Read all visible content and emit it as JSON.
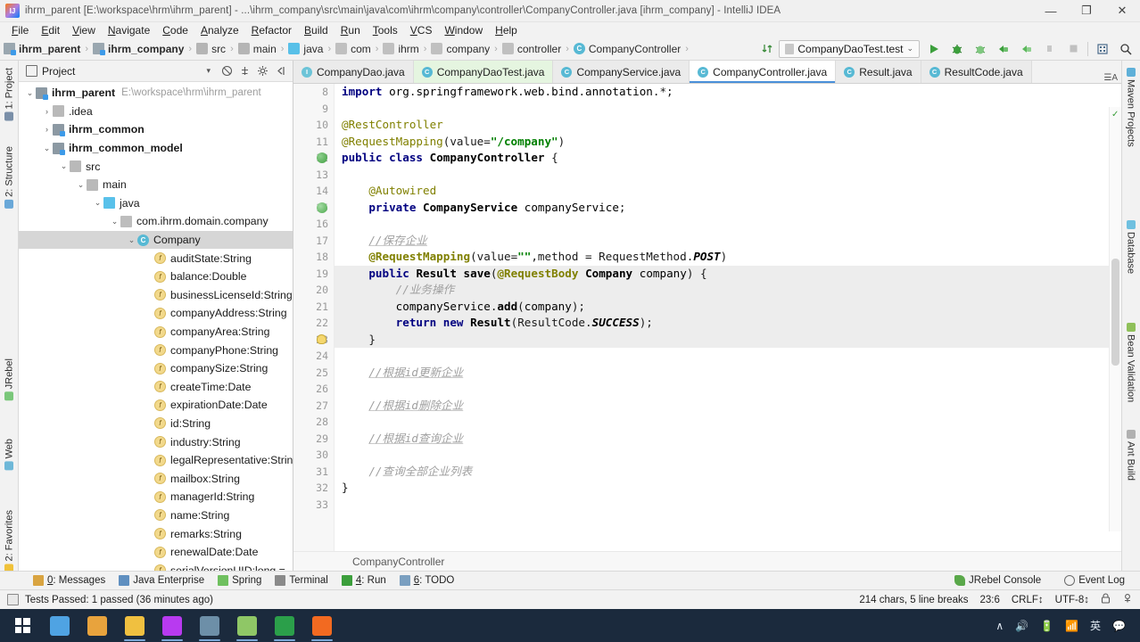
{
  "window": {
    "title": "ihrm_parent [E:\\workspace\\hrm\\ihrm_parent] - ...\\ihrm_company\\src\\main\\java\\com\\ihrm\\company\\controller\\CompanyController.java [ihrm_company] - IntelliJ IDEA",
    "minimize": "—",
    "maximize": "❐",
    "close": "✕"
  },
  "menu": [
    "File",
    "Edit",
    "View",
    "Navigate",
    "Code",
    "Analyze",
    "Refactor",
    "Build",
    "Run",
    "Tools",
    "VCS",
    "Window",
    "Help"
  ],
  "breadcrumb": [
    {
      "label": "ihrm_parent",
      "icon": "module-icon",
      "bold": true
    },
    {
      "label": "ihrm_company",
      "icon": "module-icon",
      "bold": true
    },
    {
      "label": "src",
      "icon": "folder-icon",
      "bold": false
    },
    {
      "label": "main",
      "icon": "folder-icon",
      "bold": false
    },
    {
      "label": "java",
      "icon": "java-source-folder-icon",
      "bold": false
    },
    {
      "label": "com",
      "icon": "package-icon",
      "bold": false
    },
    {
      "label": "ihrm",
      "icon": "package-icon",
      "bold": false
    },
    {
      "label": "company",
      "icon": "package-icon",
      "bold": false
    },
    {
      "label": "controller",
      "icon": "package-icon",
      "bold": false
    },
    {
      "label": "CompanyController",
      "icon": "class-icon",
      "bold": false
    }
  ],
  "run_config": {
    "name": "CompanyDaoTest.test",
    "caret": "⌄",
    "buttons": [
      "run-icon",
      "debug-icon",
      "run-coverage-icon",
      "profile-icon",
      "attach-icon",
      "stop-icon",
      "stop-disabled-icon",
      "layout-icon",
      "search-everywhere-icon"
    ]
  },
  "left_tool_strip": [
    {
      "label": "1: Project",
      "underline": "1"
    },
    {
      "label": "2: Structure",
      "underline": "2"
    },
    {
      "label": "JRebel",
      "underline": ""
    },
    {
      "label": "Web",
      "underline": ""
    },
    {
      "label": "2: Favorites",
      "underline": "2"
    }
  ],
  "right_tool_strip": [
    {
      "label": "Maven Projects"
    },
    {
      "label": "Database"
    },
    {
      "label": "Bean Validation"
    },
    {
      "label": "Ant Build"
    }
  ],
  "project_panel": {
    "title": "Project",
    "caret": "▾",
    "buttons": [
      "collapse-all-icon",
      "expand-all-icon",
      "settings-icon",
      "hide-icon"
    ],
    "tree": [
      {
        "depth": 0,
        "arrow": "⌄",
        "icon": "module-icon",
        "name": "ihrm_parent",
        "bold": true,
        "path": "E:\\workspace\\hrm\\ihrm_parent",
        "selected": false
      },
      {
        "depth": 1,
        "arrow": "›",
        "icon": "folder-icon",
        "name": ".idea",
        "bold": false,
        "path": "",
        "selected": false
      },
      {
        "depth": 1,
        "arrow": "›",
        "icon": "module-icon",
        "name": "ihrm_common",
        "bold": true,
        "path": "",
        "selected": false
      },
      {
        "depth": 1,
        "arrow": "⌄",
        "icon": "module-icon",
        "name": "ihrm_common_model",
        "bold": true,
        "path": "",
        "selected": false
      },
      {
        "depth": 2,
        "arrow": "⌄",
        "icon": "folder-icon",
        "name": "src",
        "bold": false,
        "path": "",
        "selected": false
      },
      {
        "depth": 3,
        "arrow": "⌄",
        "icon": "folder-icon",
        "name": "main",
        "bold": false,
        "path": "",
        "selected": false
      },
      {
        "depth": 4,
        "arrow": "⌄",
        "icon": "java-source-folder-icon",
        "name": "java",
        "bold": false,
        "path": "",
        "selected": false
      },
      {
        "depth": 5,
        "arrow": "⌄",
        "icon": "package-icon",
        "name": "com.ihrm.domain.company",
        "bold": false,
        "path": "",
        "selected": false
      },
      {
        "depth": 6,
        "arrow": "⌄",
        "icon": "class-icon",
        "name": "Company",
        "bold": false,
        "path": "",
        "selected": true
      },
      {
        "depth": 7,
        "arrow": "",
        "icon": "field-icon",
        "name": "auditState:String",
        "bold": false,
        "path": "",
        "selected": false
      },
      {
        "depth": 7,
        "arrow": "",
        "icon": "field-icon",
        "name": "balance:Double",
        "bold": false,
        "path": "",
        "selected": false
      },
      {
        "depth": 7,
        "arrow": "",
        "icon": "field-icon",
        "name": "businessLicenseId:String",
        "bold": false,
        "path": "",
        "selected": false
      },
      {
        "depth": 7,
        "arrow": "",
        "icon": "field-icon",
        "name": "companyAddress:String",
        "bold": false,
        "path": "",
        "selected": false
      },
      {
        "depth": 7,
        "arrow": "",
        "icon": "field-icon",
        "name": "companyArea:String",
        "bold": false,
        "path": "",
        "selected": false
      },
      {
        "depth": 7,
        "arrow": "",
        "icon": "field-icon",
        "name": "companyPhone:String",
        "bold": false,
        "path": "",
        "selected": false
      },
      {
        "depth": 7,
        "arrow": "",
        "icon": "field-icon",
        "name": "companySize:String",
        "bold": false,
        "path": "",
        "selected": false
      },
      {
        "depth": 7,
        "arrow": "",
        "icon": "field-icon",
        "name": "createTime:Date",
        "bold": false,
        "path": "",
        "selected": false
      },
      {
        "depth": 7,
        "arrow": "",
        "icon": "field-icon",
        "name": "expirationDate:Date",
        "bold": false,
        "path": "",
        "selected": false
      },
      {
        "depth": 7,
        "arrow": "",
        "icon": "field-icon",
        "name": "id:String",
        "bold": false,
        "path": "",
        "selected": false
      },
      {
        "depth": 7,
        "arrow": "",
        "icon": "field-icon",
        "name": "industry:String",
        "bold": false,
        "path": "",
        "selected": false
      },
      {
        "depth": 7,
        "arrow": "",
        "icon": "field-icon",
        "name": "legalRepresentative:Strin",
        "bold": false,
        "path": "",
        "selected": false
      },
      {
        "depth": 7,
        "arrow": "",
        "icon": "field-icon",
        "name": "mailbox:String",
        "bold": false,
        "path": "",
        "selected": false
      },
      {
        "depth": 7,
        "arrow": "",
        "icon": "field-icon",
        "name": "managerId:String",
        "bold": false,
        "path": "",
        "selected": false
      },
      {
        "depth": 7,
        "arrow": "",
        "icon": "field-icon",
        "name": "name:String",
        "bold": false,
        "path": "",
        "selected": false
      },
      {
        "depth": 7,
        "arrow": "",
        "icon": "field-icon",
        "name": "remarks:String",
        "bold": false,
        "path": "",
        "selected": false
      },
      {
        "depth": 7,
        "arrow": "",
        "icon": "field-icon",
        "name": "renewalDate:Date",
        "bold": false,
        "path": "",
        "selected": false
      },
      {
        "depth": 7,
        "arrow": "",
        "icon": "field-icon",
        "name": "serialVersionUID:long  =",
        "bold": false,
        "path": "",
        "selected": false
      }
    ]
  },
  "editor_tabs": [
    {
      "label": "CompanyDao.java",
      "icon": "interface-icon",
      "state": "plain"
    },
    {
      "label": "CompanyDaoTest.java",
      "icon": "class-icon",
      "state": "green"
    },
    {
      "label": "CompanyService.java",
      "icon": "class-icon",
      "state": "plain"
    },
    {
      "label": "CompanyController.java",
      "icon": "class-icon",
      "state": "active"
    },
    {
      "label": "Result.java",
      "icon": "class-icon",
      "state": "plain"
    },
    {
      "label": "ResultCode.java",
      "icon": "class-icon",
      "state": "plain"
    }
  ],
  "editor": {
    "first_line": 8,
    "lines": [
      {
        "n": 8,
        "marker": "",
        "html": "<span class=\"k\">import</span> <span class=\"id\">org</span>.<span class=\"id\">springframework</span>.<span class=\"id\">web</span>.<span class=\"id\">bind</span>.<span class=\"id\">annotation</span>.*;",
        "text": "import org.springframework.web.bind.annotation.*;"
      },
      {
        "n": 9,
        "marker": "",
        "html": "",
        "text": ""
      },
      {
        "n": 10,
        "marker": "",
        "html": "<span class=\"ann2\">@RestController</span>",
        "text": "@RestController"
      },
      {
        "n": 11,
        "marker": "",
        "html": "<span class=\"ann2\">@RequestMapping</span>(value=<span class=\"str\">\"/company\"</span>)",
        "text": "@RequestMapping(value=\"/company\")"
      },
      {
        "n": 12,
        "marker": "bean-icon",
        "html": "<span class=\"k\">public</span> <span class=\"k\">class</span> <span class=\"ty\">CompanyController</span> {",
        "text": "public class CompanyController {"
      },
      {
        "n": 13,
        "marker": "",
        "html": "",
        "text": ""
      },
      {
        "n": 14,
        "marker": "",
        "html": "    <span class=\"ann2\">@Autowired</span>",
        "text": "    @Autowired"
      },
      {
        "n": 15,
        "marker": "autowire-icon",
        "html": "    <span class=\"k\">private</span> <span class=\"ty\">CompanyService</span> <span class=\"id\">companyService</span>;",
        "text": "    private CompanyService companyService;"
      },
      {
        "n": 16,
        "marker": "",
        "html": "",
        "text": ""
      },
      {
        "n": 17,
        "marker": "",
        "html": "    <span class=\"cm-u\">//保存企业</span>",
        "text": "    //保存企业"
      },
      {
        "n": 18,
        "marker": "",
        "html": "    <span class=\"ann\">@RequestMapping</span>(value=<span class=\"str\">\"\"</span>,method = RequestMethod.<span class=\"st\">POST</span>)",
        "text": "    @RequestMapping(value=\"\",method = RequestMethod.POST)"
      },
      {
        "n": 19,
        "marker": "",
        "html": "    <span class=\"k\">public</span> <span class=\"ty\">Result</span> <span class=\"ty\">save</span>(<span class=\"ann\">@RequestBody</span> <span class=\"ty\">Company</span> <span class=\"id\">company</span>) {",
        "text": "    public Result save(@RequestBody Company company) {"
      },
      {
        "n": 20,
        "marker": "",
        "html": "        <span class=\"cm\">//业务操作</span>",
        "text": "        //业务操作"
      },
      {
        "n": 21,
        "marker": "",
        "html": "        <span class=\"id\">companyService</span>.<span class=\"ty\">add</span>(<span class=\"id\">company</span>);",
        "text": "        companyService.add(company);"
      },
      {
        "n": 22,
        "marker": "",
        "html": "        <span class=\"k\">return</span> <span class=\"k\">new</span> <span class=\"ty\">Result</span>(ResultCode.<span class=\"st\">SUCCESS</span>);",
        "text": "        return new Result(ResultCode.SUCCESS);"
      },
      {
        "n": 23,
        "marker": "bulb-icon",
        "html": "    }",
        "text": "    }"
      },
      {
        "n": 24,
        "marker": "",
        "html": "",
        "text": ""
      },
      {
        "n": 25,
        "marker": "",
        "html": "    <span class=\"cm-u\">//根据id更新企业</span>",
        "text": "    //根据id更新企业"
      },
      {
        "n": 26,
        "marker": "",
        "html": "",
        "text": ""
      },
      {
        "n": 27,
        "marker": "",
        "html": "    <span class=\"cm-u\">//根据id删除企业</span>",
        "text": "    //根据id删除企业"
      },
      {
        "n": 28,
        "marker": "",
        "html": "",
        "text": ""
      },
      {
        "n": 29,
        "marker": "",
        "html": "    <span class=\"cm-u\">//根据id查询企业</span>",
        "text": "    //根据id查询企业"
      },
      {
        "n": 30,
        "marker": "",
        "html": "",
        "text": ""
      },
      {
        "n": 31,
        "marker": "",
        "html": "    <span class=\"cm\">//查询全部企业列表</span>",
        "text": "    //查询全部企业列表"
      },
      {
        "n": 32,
        "marker": "",
        "html": "}",
        "text": "}"
      },
      {
        "n": 33,
        "marker": "",
        "html": "",
        "text": ""
      }
    ],
    "breadcrumb_footer": "CompanyController"
  },
  "bottom_bar": {
    "items": [
      {
        "label": "0: Messages",
        "underline": "0",
        "icon": "messages-icon"
      },
      {
        "label": "Java Enterprise",
        "underline": "",
        "icon": "java-enterprise-icon"
      },
      {
        "label": "Spring",
        "underline": "",
        "icon": "spring-icon"
      },
      {
        "label": "Terminal",
        "underline": "",
        "icon": "terminal-icon"
      },
      {
        "label": "4: Run",
        "underline": "4",
        "icon": "run-icon"
      },
      {
        "label": "6: TODO",
        "underline": "6",
        "icon": "todo-icon"
      }
    ],
    "right": [
      {
        "label": "JRebel Console",
        "icon": "jrebel-icon"
      },
      {
        "label": "Event Log",
        "icon": "event-log-icon"
      }
    ]
  },
  "status_bar": {
    "message": "Tests Passed: 1 passed (36 minutes ago)",
    "right": [
      "214 chars, 5 line breaks",
      "23:6",
      "CRLF↕",
      "UTF-8↕"
    ],
    "lock_icon": "lock-icon",
    "inspector_icon": "inspector-icon"
  },
  "taskbar": {
    "start": "windows-start-icon",
    "apps": [
      {
        "name": "paint-icon",
        "color": "#4fa3e3"
      },
      {
        "name": "office-icon",
        "color": "#e8a33d"
      },
      {
        "name": "file-explorer-icon",
        "color": "#f0c040"
      },
      {
        "name": "intellij-idea-icon",
        "color": "#b83af0"
      },
      {
        "name": "navicat-dolphin-icon",
        "color": "#6d8fa8"
      },
      {
        "name": "image-viewer-icon",
        "color": "#8fc766"
      },
      {
        "name": "google-chrome-icon",
        "color": "#2b9f4a"
      },
      {
        "name": "recorder-icon",
        "color": "#f26a21"
      }
    ],
    "tray": [
      "∧",
      "🔊",
      "🔋",
      "📶",
      "英",
      "💬"
    ]
  },
  "colors": {
    "accent": "#4a90d9",
    "panel": "#f2f2f2",
    "editor_bg": "#ffffff",
    "selection": "#d6d6d6",
    "taskbar": "#1b2a3d"
  }
}
